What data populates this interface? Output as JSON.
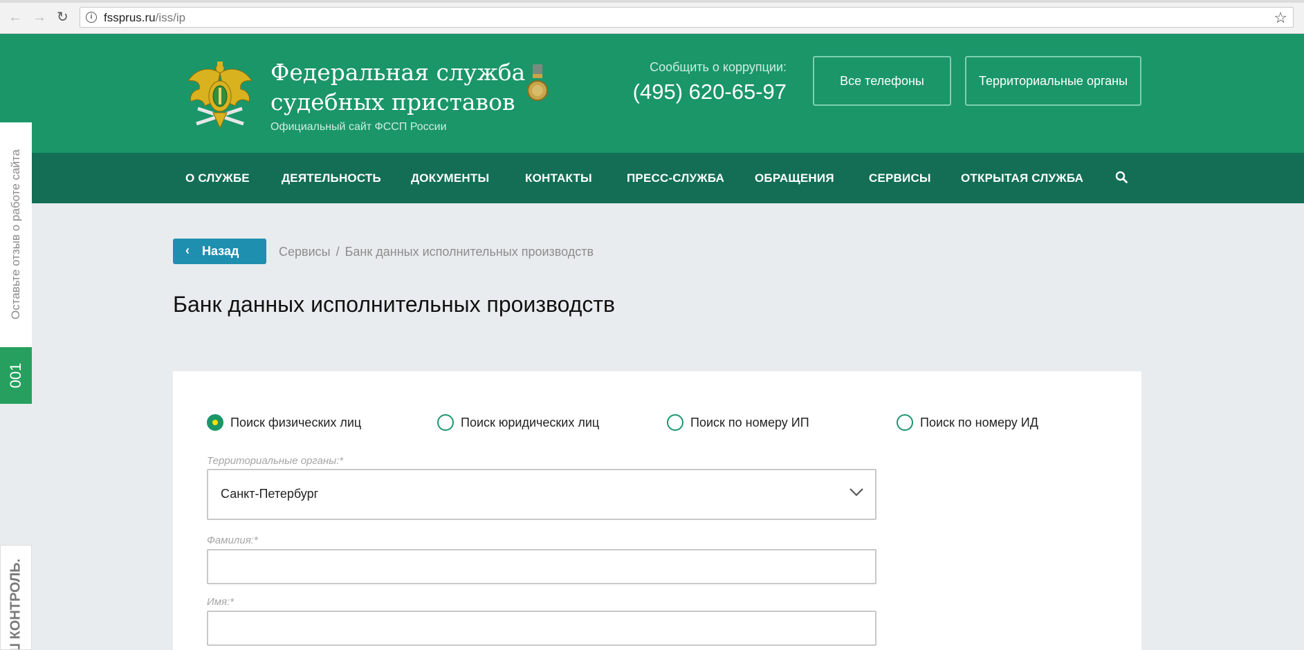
{
  "browser": {
    "url_domain": "fssprus.ru",
    "url_path": "/iss/ip"
  },
  "header": {
    "title_line1": "Федеральная служба",
    "title_line2": "судебных приставов",
    "subtitle": "Официальный сайт ФССП России",
    "corruption_label": "Сообщить о коррупции:",
    "corruption_phone": "(495) 620-65-97",
    "all_phones_label": "Все телефоны",
    "territorial_label": "Территориальные органы"
  },
  "nav": {
    "items": [
      "О СЛУЖБЕ",
      "ДЕЯТЕЛЬНОСТЬ",
      "ДОКУМЕНТЫ",
      "КОНТАКТЫ",
      "ПРЕСС-СЛУЖБА",
      "ОБРАЩЕНИЯ",
      "СЕРВИСЫ",
      "ОТКРЫТАЯ СЛУЖБА"
    ]
  },
  "side": {
    "feedback": "Оставьте отзыв о работе сайта",
    "counter": "001",
    "control": "Ш КОНТРОЛЬ."
  },
  "content": {
    "back_label": "Назад",
    "breadcrumb": [
      "Сервисы",
      "Банк данных исполнительных производств"
    ],
    "page_title": "Банк данных исполнительных производств"
  },
  "form": {
    "search_types": [
      {
        "label": "Поиск физических лиц",
        "checked": true
      },
      {
        "label": "Поиск юридических лиц",
        "checked": false
      },
      {
        "label": "Поиск по номеру ИП",
        "checked": false
      },
      {
        "label": "Поиск по номеру ИД",
        "checked": false
      }
    ],
    "region_label": "Территориальные органы:*",
    "region_value": "Санкт-Петербург",
    "lastname_label": "Фамилия:*",
    "lastname_value": "",
    "firstname_label": "Имя:*",
    "firstname_value": ""
  },
  "colors": {
    "header_green": "#1a9669",
    "nav_green": "#136e55",
    "back_button_blue": "#1f8fb0",
    "radio_dot_yellow": "#ffe000"
  }
}
